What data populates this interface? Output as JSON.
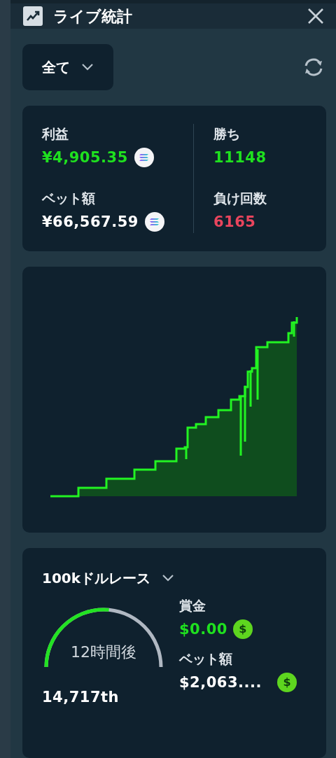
{
  "header": {
    "title": "ライブ統計"
  },
  "filter": {
    "label": "全て"
  },
  "stats": {
    "left": [
      {
        "label": "利益",
        "value": "¥4,905.35",
        "color": "#1fe01f"
      },
      {
        "label": "ベット額",
        "value": "¥66,567.59",
        "color": "#ffffff"
      }
    ],
    "right": [
      {
        "label": "勝ち",
        "value": "11148",
        "color": "#1fe01f"
      },
      {
        "label": "負け回数",
        "value": "6165",
        "color": "#e9455d"
      }
    ]
  },
  "race": {
    "title": "100kドルレース",
    "timer": {
      "label": "12時間後"
    },
    "rank": "14,717th",
    "items": [
      {
        "label": "賞金",
        "value": "$0.00",
        "color": "#1fe01f",
        "coin": "$"
      },
      {
        "label": "ベット額",
        "value": "$2,063....",
        "color": "#ffffff",
        "coin": "$"
      }
    ]
  }
}
